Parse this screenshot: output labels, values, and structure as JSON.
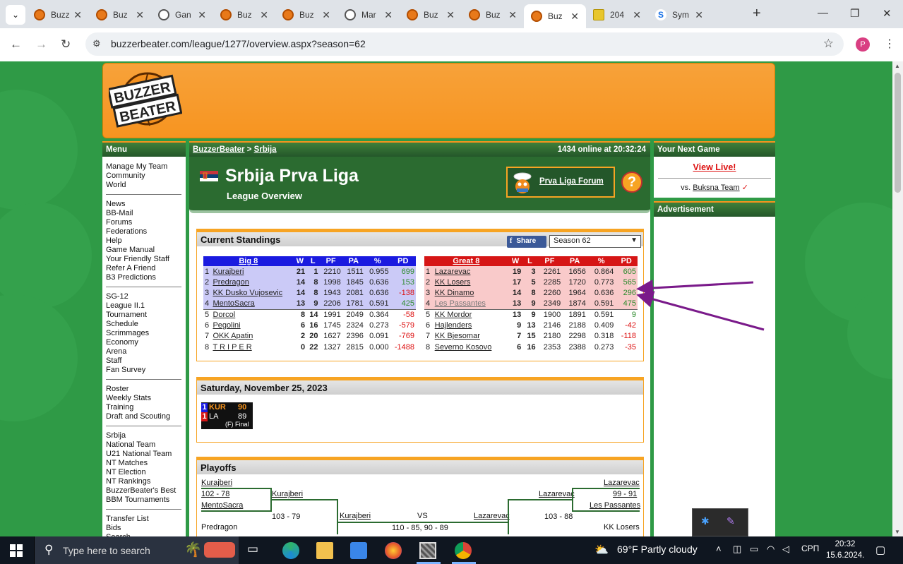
{
  "browser": {
    "tabs": [
      {
        "label": "Buzz",
        "icon": "bb-ball"
      },
      {
        "label": "Buz",
        "icon": "bb-ball"
      },
      {
        "label": "Gan",
        "icon": "gauge"
      },
      {
        "label": "Buz",
        "icon": "bb-ball"
      },
      {
        "label": "Buz",
        "icon": "bb-ball"
      },
      {
        "label": "Mar",
        "icon": "link"
      },
      {
        "label": "Buz",
        "icon": "bb-ball"
      },
      {
        "label": "Buz",
        "icon": "bb-ball"
      },
      {
        "label": "Buz",
        "icon": "bb-ball",
        "active": true
      },
      {
        "label": "204",
        "icon": "2048"
      },
      {
        "label": "Sym",
        "icon": "sg"
      }
    ],
    "url": "buzzerbeater.com/league/1277/overview.aspx?season=62",
    "profile_initial": "P"
  },
  "site": {
    "logo_text": "BUZZER BEATER",
    "menu_title": "Menu",
    "menu_groups": [
      [
        "Manage My Team",
        "Community",
        "World"
      ],
      [
        "News",
        "BB-Mail",
        "Forums",
        "Federations",
        "Help",
        "Game Manual",
        "Your Friendly Staff",
        "Refer A Friend",
        "B3 Predictions"
      ],
      [
        "SG-12",
        "League II.1",
        "Tournament",
        "Schedule",
        "Scrimmages",
        "Economy",
        "Arena",
        "Staff",
        "Fan Survey"
      ],
      [
        "Roster",
        "Weekly Stats",
        "Training",
        "Draft and Scouting"
      ],
      [
        "Srbija",
        "National Team",
        "U21 National Team",
        "NT Matches",
        "NT Election",
        "NT Rankings",
        "BuzzerBeater's Best",
        "BBM Tournaments"
      ],
      [
        "Transfer List",
        "Bids",
        "Search"
      ]
    ],
    "breadcrumb": {
      "root": "BuzzerBeater",
      "sep": ">",
      "current": "Srbija"
    },
    "online": "1434 online at 20:32:24",
    "next_game_title": "Your Next Game",
    "view_live": "View Live!",
    "vs_prefix": "vs.",
    "vs_team": "Buksna Team",
    "vs_check": "✓",
    "ad_title": "Advertisement"
  },
  "league": {
    "title": "Srbija Prva Liga",
    "subtitle": "League Overview",
    "forum_link": "Prva Liga Forum",
    "help": "?"
  },
  "standings": {
    "title": "Current Standings",
    "share": "Share",
    "season": "Season 62",
    "columns": [
      "W",
      "L",
      "PF",
      "PA",
      "%",
      "PD"
    ],
    "conferences": [
      {
        "name": "Big 8",
        "color": "#1a1ae0",
        "highlight": "#cbcaf7",
        "rows": [
          {
            "rank": "1",
            "team": "Kurajberi",
            "w": "21",
            "l": "1",
            "pf": "2210",
            "pa": "1511",
            "pct": "0.955",
            "pd": "699",
            "top": true
          },
          {
            "rank": "2",
            "team": "Predragon",
            "w": "14",
            "l": "8",
            "pf": "1998",
            "pa": "1845",
            "pct": "0.636",
            "pd": "153",
            "top": true
          },
          {
            "rank": "3",
            "team": "KK Dusko Vujosevic",
            "w": "14",
            "l": "8",
            "pf": "1943",
            "pa": "2081",
            "pct": "0.636",
            "pd": "-138",
            "top": true
          },
          {
            "rank": "4",
            "team": "MentoSacra",
            "w": "13",
            "l": "9",
            "pf": "2206",
            "pa": "1781",
            "pct": "0.591",
            "pd": "425",
            "top": true
          },
          {
            "rank": "5",
            "team": "Dorcol",
            "w": "8",
            "l": "14",
            "pf": "1991",
            "pa": "2049",
            "pct": "0.364",
            "pd": "-58"
          },
          {
            "rank": "6",
            "team": "Pegolini",
            "w": "6",
            "l": "16",
            "pf": "1745",
            "pa": "2324",
            "pct": "0.273",
            "pd": "-579"
          },
          {
            "rank": "7",
            "team": "OKK Apatin",
            "w": "2",
            "l": "20",
            "pf": "1627",
            "pa": "2396",
            "pct": "0.091",
            "pd": "-769"
          },
          {
            "rank": "8",
            "team": "T R I P E R",
            "w": "0",
            "l": "22",
            "pf": "1327",
            "pa": "2815",
            "pct": "0.000",
            "pd": "-1488"
          }
        ]
      },
      {
        "name": "Great 8",
        "color": "#d61515",
        "highlight": "#f9caca",
        "rows": [
          {
            "rank": "1",
            "team": "Lazarevac",
            "w": "19",
            "l": "3",
            "pf": "2261",
            "pa": "1656",
            "pct": "0.864",
            "pd": "605",
            "top": true
          },
          {
            "rank": "2",
            "team": "KK Losers",
            "w": "17",
            "l": "5",
            "pf": "2285",
            "pa": "1720",
            "pct": "0.773",
            "pd": "565",
            "top": true
          },
          {
            "rank": "3",
            "team": "KK Dinamo",
            "w": "14",
            "l": "8",
            "pf": "2260",
            "pa": "1964",
            "pct": "0.636",
            "pd": "296",
            "top": true
          },
          {
            "rank": "4",
            "team": "Les Passantes",
            "w": "13",
            "l": "9",
            "pf": "2349",
            "pa": "1874",
            "pct": "0.591",
            "pd": "475",
            "top": true,
            "faded": true
          },
          {
            "rank": "5",
            "team": "KK Mordor",
            "w": "13",
            "l": "9",
            "pf": "1900",
            "pa": "1891",
            "pct": "0.591",
            "pd": "9"
          },
          {
            "rank": "6",
            "team": "Hajlenders",
            "w": "9",
            "l": "13",
            "pf": "2146",
            "pa": "2188",
            "pct": "0.409",
            "pd": "-42"
          },
          {
            "rank": "7",
            "team": "KK Bjesomar",
            "w": "7",
            "l": "15",
            "pf": "2180",
            "pa": "2298",
            "pct": "0.318",
            "pd": "-118"
          },
          {
            "rank": "8",
            "team": "Severno Kosovo",
            "w": "6",
            "l": "16",
            "pf": "2353",
            "pa": "2388",
            "pct": "0.273",
            "pd": "-35"
          }
        ]
      }
    ]
  },
  "games": {
    "date": "Saturday, November 25, 2023",
    "score": {
      "team1_seed": "1",
      "team1": "KUR",
      "score1": "90",
      "team2_seed": "1",
      "team2": "LA",
      "score2": "89",
      "status": "(F) Final"
    }
  },
  "playoffs": {
    "title": "Playoffs",
    "left": {
      "t1": "Kurajberi",
      "s1": "102 - 78",
      "t2": "MentoSacra",
      "winner": "Kurajberi",
      "s2": "103 - 79",
      "t3": "Predragon"
    },
    "center": {
      "left_team": "Kurajberi",
      "vs": "VS",
      "right_team": "Lazarevac",
      "scores": "110 - 85, 90 - 89"
    },
    "right": {
      "t1": "Lazarevac",
      "s1": "99 - 91",
      "t2": "Les Passantes",
      "winner": "Lazarevac",
      "s2": "103 - 88",
      "t3": "KK Losers"
    }
  },
  "taskbar": {
    "search_placeholder": "Type here to search",
    "weather": "69°F  Partly cloudy",
    "lang": "СРП",
    "time": "20:32",
    "date": "15.6.2024."
  }
}
